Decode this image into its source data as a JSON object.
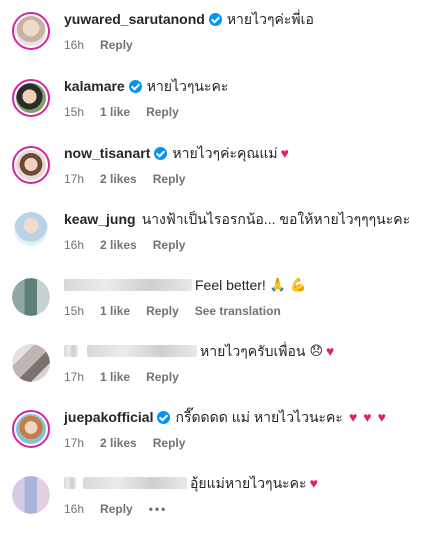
{
  "comments": [
    {
      "username": "yuwared_sarutanond",
      "verified": true,
      "text": "หายไวๆค่ะพี่เอ",
      "time": "16h",
      "likes": "",
      "reply": "Reply"
    },
    {
      "username": "kalamare",
      "verified": true,
      "text": "หายไวๆนะคะ",
      "time": "15h",
      "likes": "1 like",
      "reply": "Reply"
    },
    {
      "username": "now_tisanart",
      "verified": true,
      "text": "หายไวๆค่ะคุณแม่",
      "time": "17h",
      "likes": "2 likes",
      "reply": "Reply"
    },
    {
      "username": "keaw_jung",
      "verified": false,
      "text": "นางฟ้าเป็นไรอรกน้อ... ขอให้หายไวๆๆๆนะคะ",
      "time": "16h",
      "likes": "2 likes",
      "reply": "Reply"
    },
    {
      "username": "",
      "verified": false,
      "text": "Feel better!",
      "time": "15h",
      "likes": "1 like",
      "reply": "Reply",
      "extra": "See translation"
    },
    {
      "username": "",
      "verified": false,
      "text": "หายไวๆครับเพื่อน",
      "time": "17h",
      "likes": "1 like",
      "reply": "Reply"
    },
    {
      "username": "juepakofficial",
      "verified": true,
      "text": "กรี๊ดดดด แม่ หายไวไวนะคะ",
      "time": "17h",
      "likes": "2 likes",
      "reply": "Reply"
    },
    {
      "username": "",
      "verified": false,
      "text": "อุ้ยแม่หายไวๆนะคะ",
      "time": "16h",
      "likes": "",
      "reply": "Reply",
      "more": "•••"
    }
  ],
  "colors": {
    "verified_badge": "#0095f6",
    "heart": "#e0245e",
    "story_ring": "#d6249f",
    "meta_text": "#737373"
  }
}
